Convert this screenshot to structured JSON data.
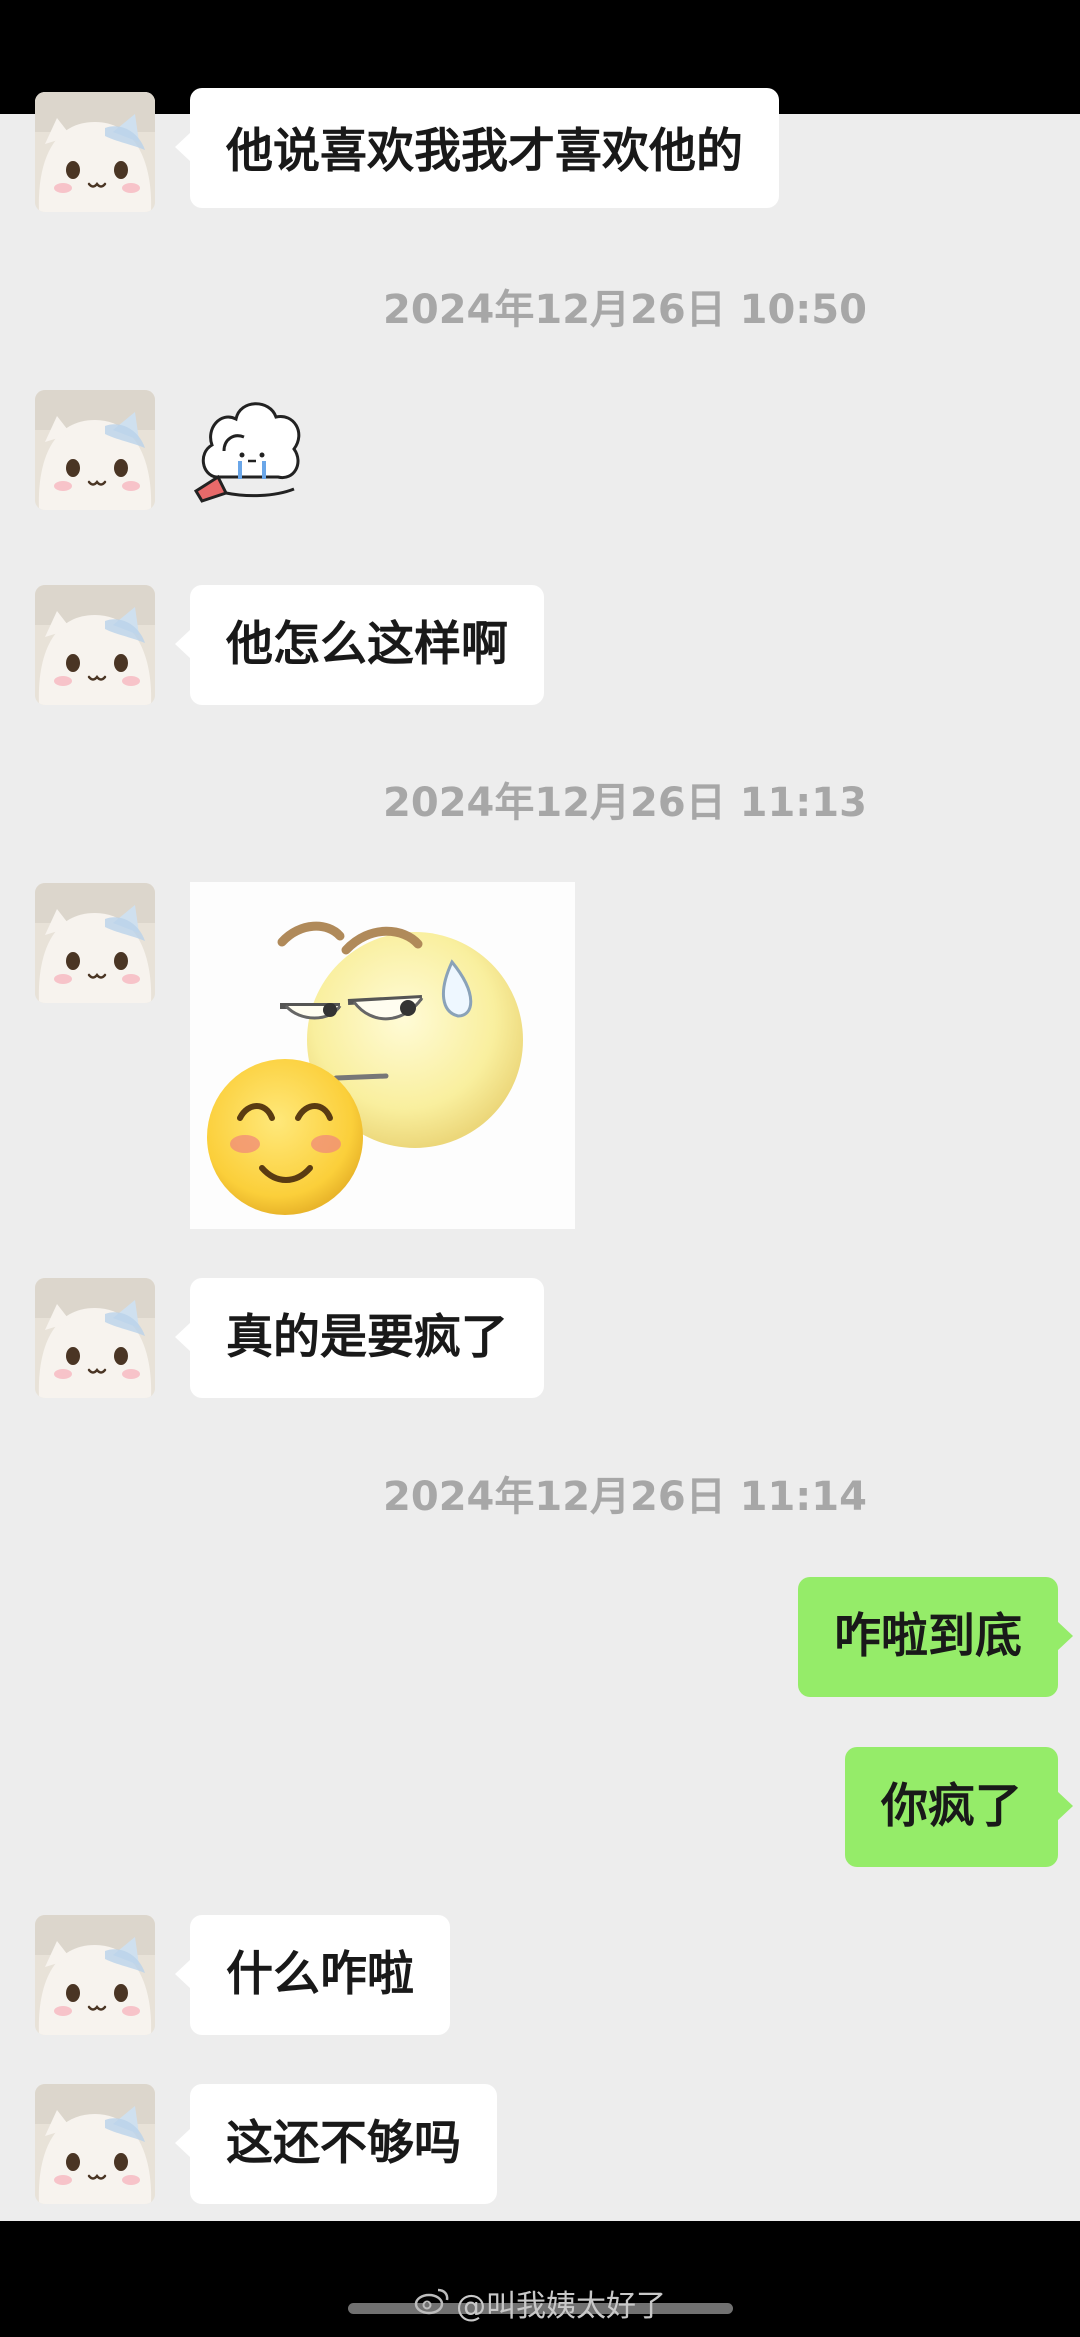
{
  "messages": [
    {
      "side": "left",
      "type": "text",
      "text": "他说喜欢我我才喜欢他的"
    },
    {
      "type": "time",
      "text": "2024年12月26日 10:50"
    },
    {
      "side": "left",
      "type": "sticker",
      "sticker": "crying-bunny-sticker"
    },
    {
      "side": "left",
      "type": "text",
      "text": "他怎么这样啊"
    },
    {
      "type": "time",
      "text": "2024年12月26日 11:13"
    },
    {
      "side": "left",
      "type": "sticker",
      "sticker": "smiling-and-sweating-emoji-sticker"
    },
    {
      "side": "left",
      "type": "text",
      "text": "真的是要疯了"
    },
    {
      "type": "time",
      "text": "2024年12月26日 11:14"
    },
    {
      "side": "right",
      "type": "text",
      "text": "咋啦到底"
    },
    {
      "side": "right",
      "type": "text",
      "text": "你疯了"
    },
    {
      "side": "left",
      "type": "text",
      "text": "什么咋啦"
    },
    {
      "side": "left",
      "type": "text",
      "text": "这还不够吗"
    }
  ],
  "watermark": {
    "text": "@叫我姨太好了",
    "icon": "weibo-icon"
  },
  "colors": {
    "background": "#ededed",
    "own_bubble": "#95ec69",
    "other_bubble": "#ffffff",
    "timestamp": "#a7a7a7"
  }
}
